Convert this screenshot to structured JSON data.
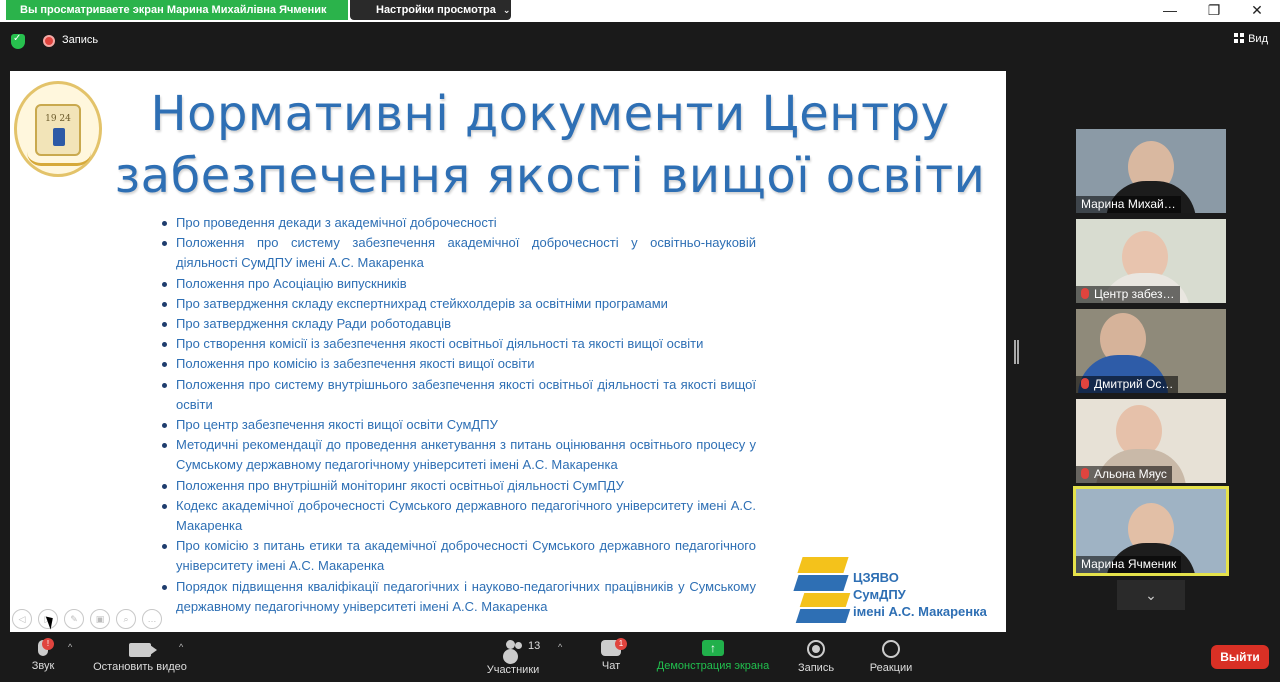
{
  "window": {
    "share_banner": "Вы просматриваете экран Марина Михайлівна Ячменик",
    "view_settings_label": "Настройки просмотра",
    "minimize": "—",
    "restore": "❐",
    "close": "✕"
  },
  "topbar": {
    "record_label": "Запись",
    "view_label": "Вид"
  },
  "slide": {
    "crest_year": "19  24",
    "title_line1": "Нормативні документи Центру",
    "title_line2": "забезпечення якості вищої освіти",
    "documents": [
      "Про проведення декади з академічної доброчесності",
      "Положення про систему забезпечення академічної доброчесності у освітньо-науковій діяльності СумДПУ імені А.С. Макаренка",
      "Положення про Асоціацію випускників",
      "Про затвердження складу експертнихрад стейкхолдерів за освітніми програмами",
      "Про затвердження складу Ради роботодавців",
      "Про створення комісії із забезпечення якості освітньої діяльності та якості вищої освіти",
      "Положення про комісію із забезпечення якості вищої освіти",
      "Положення про систему внутрішнього забезпечення якості освітньої діяльності та якості вищої освіти",
      "Про центр забезпечення якості вищої освіти СумДПУ",
      "Методичні рекомендації до проведення анкетування з питань оцінювання освітнього процесу у Сумському державному педагогічному університеті імені А.С. Макаренка",
      "Положення про внутрішній моніторинг якості освітньої діяльності СумПДУ",
      "Кодекс академічної доброчесності Сумського державного педагогічного університету імені А.С. Макаренка",
      "Про комісію з питань етики та академічної доброчесності Сумського державного педагогічного університету імені А.С. Макаренка",
      "Порядок підвищення кваліфікації педагогічних і науково-педагогічних працівників у Сумському державному педагогічному університеті імені А.С. Макаренка"
    ],
    "logo_line1": "ЦЗЯВО",
    "logo_line2": "СумДПУ",
    "logo_line3": "імені А.С. Макаренка"
  },
  "participants": [
    {
      "name": "Марина Михай…",
      "muted": false,
      "bg": "#8b9aa6",
      "skin": "#d9b8a0",
      "shirt": "#1c1c1c"
    },
    {
      "name": "Центр забез…",
      "muted": true,
      "bg": "#d8dcd0",
      "skin": "#e8c4ae",
      "shirt": "#e9e6e0"
    },
    {
      "name": "Дмитрий Ос…",
      "muted": true,
      "bg": "#8f8a7a",
      "skin": "#d6b39a",
      "shirt": "#2e5ca8"
    },
    {
      "name": "Альона Мяус",
      "muted": true,
      "bg": "#e7e1d6",
      "skin": "#e6c1aa",
      "shirt": "#c9b9a8"
    },
    {
      "name": "Марина Ячменик",
      "muted": false,
      "bg": "#9fb3c4",
      "skin": "#e2bfa6",
      "shirt": "#1d1d1d"
    }
  ],
  "more_participants": "⌄",
  "toolbar": {
    "audio_label": "Звук",
    "audio_badge": "!",
    "video_label": "Остановить видео",
    "participants_label": "Участники",
    "participants_count": "13",
    "chat_label": "Чат",
    "chat_badge": "1",
    "share_label": "Демонстрация экрана",
    "share_icon": "↑",
    "record_label": "Запись",
    "reactions_label": "Реакции",
    "leave_label": "Выйти",
    "caret": "^"
  },
  "colors": {
    "accent_green": "#2bb34b",
    "slide_blue": "#2e6fb4",
    "leave_red": "#d93025",
    "active_border": "#e5e24b"
  }
}
